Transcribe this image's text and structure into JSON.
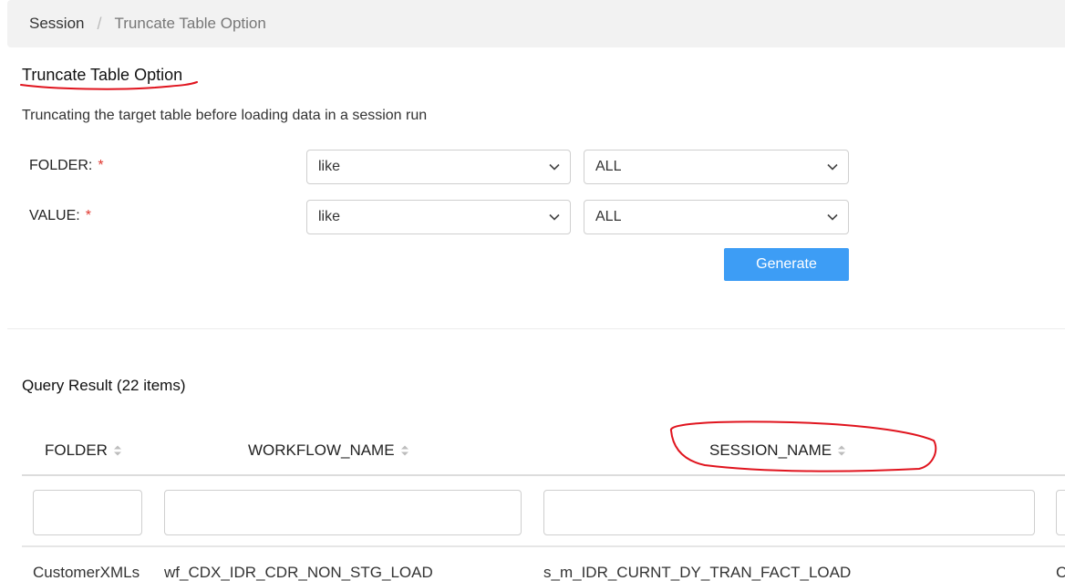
{
  "breadcrumb": {
    "parent": "Session",
    "separator": "/",
    "current": "Truncate Table Option"
  },
  "page": {
    "title": "Truncate Table Option",
    "description": "Truncating the target table before loading data in a session run"
  },
  "form": {
    "folder": {
      "label": "FOLDER:",
      "required_mark": "*",
      "operator": "like",
      "value": "ALL"
    },
    "value": {
      "label": "VALUE:",
      "required_mark": "*",
      "operator": "like",
      "value": "ALL"
    },
    "generate_label": "Generate"
  },
  "result": {
    "title": "Query Result (22 items)",
    "columns": [
      {
        "label": "FOLDER"
      },
      {
        "label": "WORKFLOW_NAME"
      },
      {
        "label": "SESSION_NAME"
      }
    ],
    "filters": [
      "",
      "",
      "",
      ""
    ],
    "rows": [
      {
        "folder": "CustomerXMLs",
        "workflow": "wf_CDX_IDR_CDR_NON_STG_LOAD",
        "session": "s_m_IDR_CURNT_DY_TRAN_FACT_LOAD",
        "extra": "C"
      }
    ]
  },
  "colors": {
    "accent": "#3d9df5",
    "required": "#e0372f",
    "annotation": "#e0141e"
  },
  "icons": {
    "select": "chevron-down-icon",
    "sort": "sort-icon"
  }
}
